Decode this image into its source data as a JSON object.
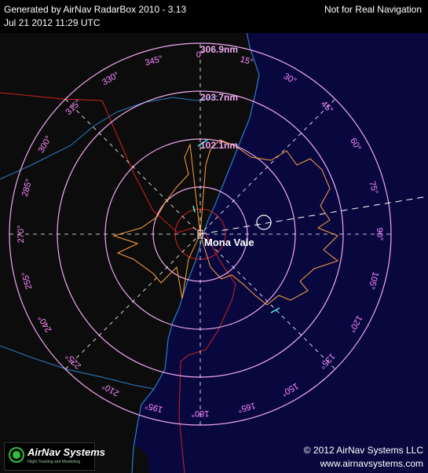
{
  "header": {
    "title": "Generated by AirNav RadarBox 2010 - 3.13",
    "timestamp": "Jul 21 2012 11:29 UTC",
    "warning": "Not for Real Navigation"
  },
  "footer": {
    "copyright": "© 2012 AirNav Systems LLC",
    "url": "www.airnavsystems.com"
  },
  "logo": {
    "name": "AirNav Systems",
    "tagline": "Flight Tracking and Monitoring"
  },
  "station": {
    "name": "Mona Vale"
  },
  "range_rings": [
    "102.1nm",
    "203.7nm",
    "306.9nm"
  ],
  "bearings": [
    "0°",
    "15°",
    "30°",
    "45°",
    "60°",
    "75°",
    "90°",
    "105°",
    "120°",
    "135°",
    "150°",
    "165°",
    "180°",
    "195°",
    "210°",
    "225°",
    "240°",
    "255°",
    "270°",
    "285°",
    "300°",
    "315°",
    "330°",
    "345°"
  ],
  "colors": {
    "ocean": "#08083f",
    "land": "#0c0c0c",
    "coastline": "#2a7dc4",
    "ring": "#f0a8f0",
    "label": "#ff88ff",
    "coverage": "#ffa040",
    "boundary": "#d02020"
  }
}
